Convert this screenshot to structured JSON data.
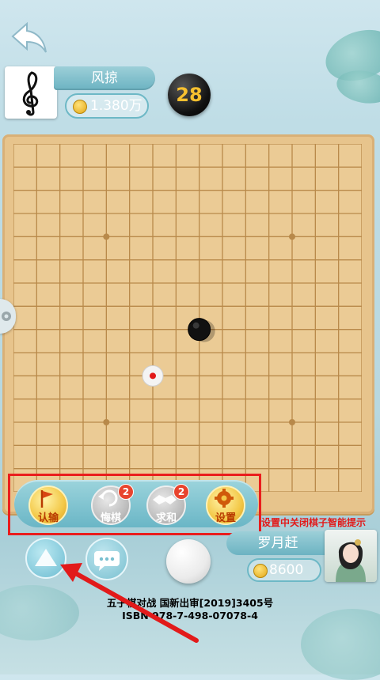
{
  "header": {
    "back_icon": "back-arrow-icon"
  },
  "opponent": {
    "name": "风掠",
    "coins": "1.380万",
    "avatar_icon": "treble-clef-icon"
  },
  "timer": {
    "value": "28"
  },
  "board": {
    "size": 15,
    "black_stone": [
      7,
      7
    ],
    "white_marker": [
      5,
      9
    ],
    "star_points": [
      [
        3,
        3
      ],
      [
        11,
        3
      ],
      [
        3,
        11
      ],
      [
        11,
        11
      ]
    ]
  },
  "actions": [
    {
      "label": "认输",
      "icon": "flag-icon",
      "style": "gold",
      "badge": ""
    },
    {
      "label": "悔棋",
      "icon": "undo-icon",
      "style": "grey",
      "badge": "2"
    },
    {
      "label": "求和",
      "icon": "handshake-icon",
      "style": "grey",
      "badge": "2"
    },
    {
      "label": "设置",
      "icon": "gear-icon",
      "style": "gold",
      "badge": ""
    }
  ],
  "hint_text": "设置中关闭棋子智能提示",
  "player": {
    "name": "罗月赶",
    "coins": "8600"
  },
  "license": {
    "line1": "五子棋对战 国新出审[2019]3405号",
    "line2": "ISBN 978-7-498-07078-4"
  },
  "colors": {
    "highlight_red": "#ea1d1d",
    "board": "#ebcb95",
    "gold_label": "#b83a00"
  }
}
